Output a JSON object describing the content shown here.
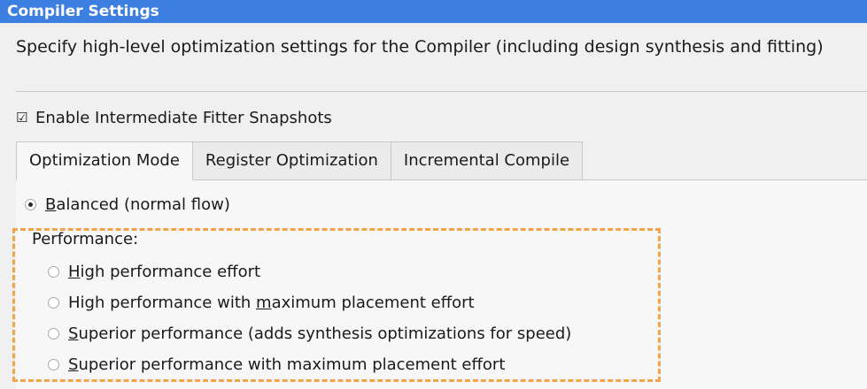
{
  "title": "Compiler Settings",
  "description": "Specify high-level optimization settings for the Compiler (including design synthesis and fitting)",
  "snapshot_checkbox": {
    "label": "Enable Intermediate Fitter Snapshots",
    "checked": true,
    "glyph": "☑"
  },
  "tabs": [
    {
      "label": "Optimization Mode",
      "active": true
    },
    {
      "label": "Register Optimization",
      "active": false
    },
    {
      "label": "Incremental Compile",
      "active": false
    }
  ],
  "optimization": {
    "balanced": {
      "mnemonic": "B",
      "rest": "alanced (normal flow)",
      "selected": true
    },
    "performance_label": "Performance:",
    "options": [
      {
        "mnemonic": "H",
        "rest": "igh performance effort",
        "selected": false
      },
      {
        "prefix": "High performance with ",
        "mnemonic": "m",
        "rest": "aximum placement effort",
        "selected": false
      },
      {
        "mnemonic": "S",
        "rest": "uperior performance (adds synthesis optimizations for speed)",
        "selected": false
      },
      {
        "mnemonic": "S",
        "rest": "uperior performance with maximum placement effort",
        "selected": false
      }
    ]
  },
  "colors": {
    "title_bar": "#3c7fe0",
    "highlight": "#f0a54a"
  }
}
